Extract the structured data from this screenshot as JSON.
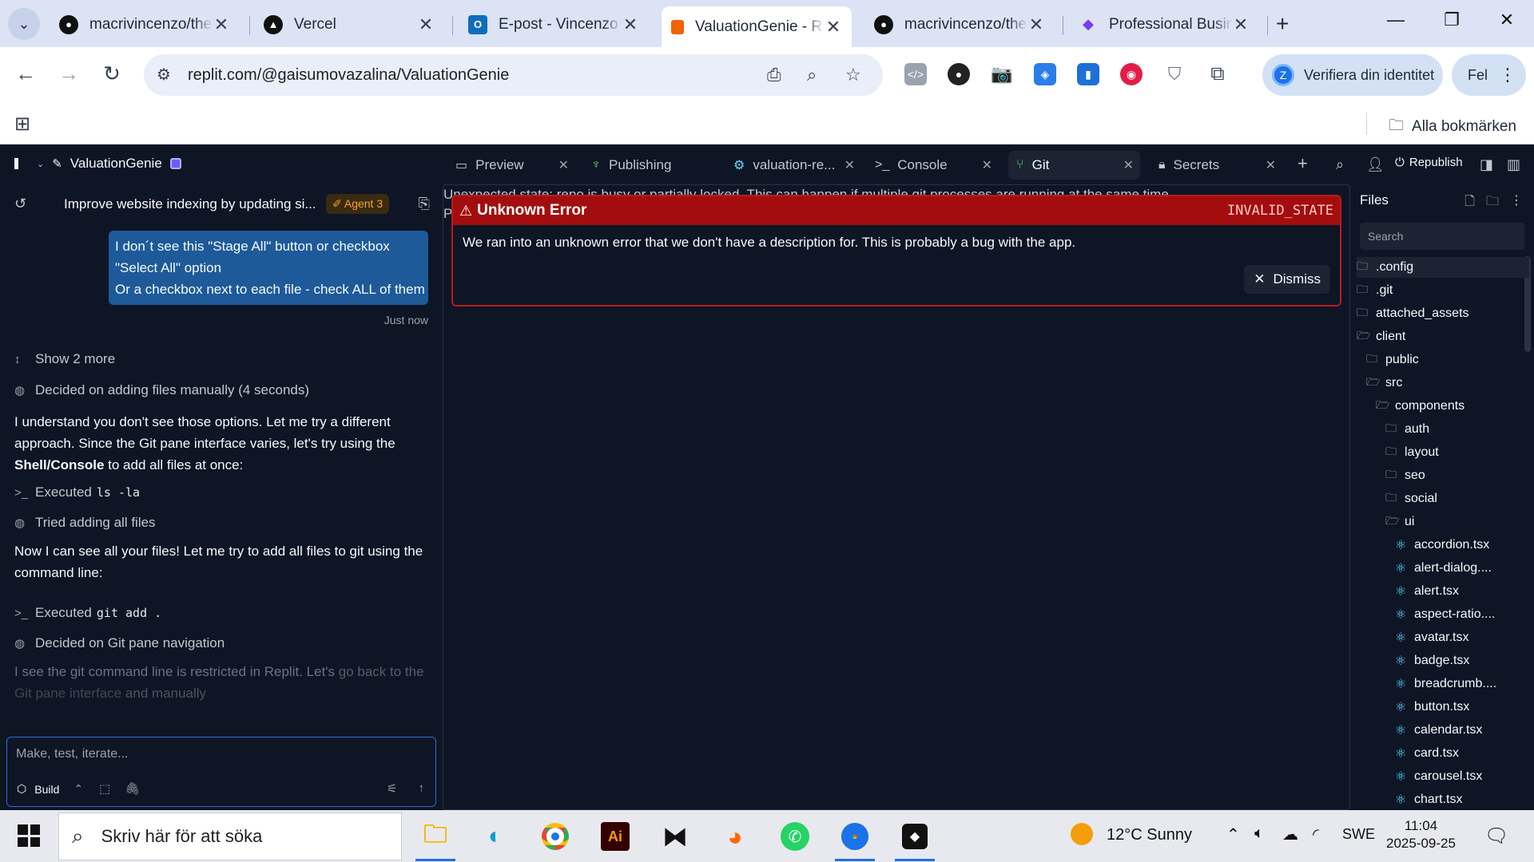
{
  "browser": {
    "tabs": [
      {
        "title": "macrivincenzo/the",
        "icon": "github-icon"
      },
      {
        "title": "Vercel",
        "icon": "vercel-icon"
      },
      {
        "title": "E-post - Vincenzo",
        "icon": "outlook-icon"
      },
      {
        "title": "ValuationGenie - R",
        "icon": "replit-icon",
        "active": true
      },
      {
        "title": "macrivincenzo/the",
        "icon": "github-icon"
      },
      {
        "title": "Professional Busin",
        "icon": "diamond-icon"
      }
    ],
    "url": "replit.com/@gaisumovazalina/ValuationGenie",
    "profile_label": "Verifiera din identitet",
    "profile_initial": "Z",
    "error_label": "Fel",
    "bookmarks_label": "Alla bokmärken"
  },
  "workspace": {
    "project_name": "ValuationGenie",
    "pane_tabs": [
      {
        "label": "Preview",
        "icon": "monitor-icon"
      },
      {
        "label": "Publishing",
        "icon": "balloon-icon"
      },
      {
        "label": "valuation-re...",
        "icon": "gear-icon"
      },
      {
        "label": "Console",
        "icon": "terminal-icon"
      },
      {
        "label": "Git",
        "icon": "git-branch-icon",
        "active": true
      },
      {
        "label": "Secrets",
        "icon": "lock-icon"
      }
    ],
    "republish_label": "Republish"
  },
  "agent": {
    "thread_title": "Improve website indexing by updating si...",
    "agent_badge": "Agent 3",
    "user_message_lines": [
      "I don´t see this \"Stage All\" button or checkbox",
      "\"Select All\" option",
      "Or a checkbox next to each file - check ALL of them"
    ],
    "timestamp": "Just now",
    "show_more": "Show 2 more",
    "decided_1": "Decided on adding files manually (4 seconds)",
    "para_1_a": "I understand you don't see those options. Let me try a different approach. Since the Git pane interface varies, let's try using the ",
    "para_1_bold": "Shell/Console",
    "para_1_b": " to add all files at once:",
    "executed_label": "Executed",
    "executed_1_cmd": "ls -la",
    "tried": "Tried adding all files",
    "para_2": "Now I can see all your files! Let me try to add all files to git using the command line:",
    "executed_2_cmd": "git add .",
    "decided_2": "Decided on Git pane navigation",
    "para_3_a": "I see the git command line is restricted in Replit. Let's ",
    "para_3_b": "go back to the",
    "para_3_c": "Git pane interface",
    "para_3_d": " and manually",
    "composer_placeholder": "Make, test, iterate...",
    "build_label": "Build"
  },
  "git_pane": {
    "bg_line": "Unexpected state: repo is busy or partially locked. This can happen if multiple git processes are running at the same time.",
    "bg_line_2": "P",
    "error_title": "Unknown Error",
    "error_code": "INVALID_STATE",
    "error_message": "We ran into an unknown error that we don't have a description for. This is probably a bug with the app.",
    "dismiss_label": "Dismiss"
  },
  "files": {
    "header": "Files",
    "search_placeholder": "Search",
    "tree": [
      {
        "name": ".config",
        "type": "folder",
        "depth": 0
      },
      {
        "name": ".git",
        "type": "folder",
        "depth": 0
      },
      {
        "name": "attached_assets",
        "type": "folder",
        "depth": 0
      },
      {
        "name": "client",
        "type": "folder-open",
        "depth": 0
      },
      {
        "name": "public",
        "type": "folder",
        "depth": 1
      },
      {
        "name": "src",
        "type": "folder-open",
        "depth": 1
      },
      {
        "name": "components",
        "type": "folder-open",
        "depth": 2
      },
      {
        "name": "auth",
        "type": "folder",
        "depth": 3
      },
      {
        "name": "layout",
        "type": "folder",
        "depth": 3
      },
      {
        "name": "seo",
        "type": "folder",
        "depth": 3
      },
      {
        "name": "social",
        "type": "folder",
        "depth": 3
      },
      {
        "name": "ui",
        "type": "folder-open",
        "depth": 3
      },
      {
        "name": "accordion.tsx",
        "type": "react",
        "depth": 4
      },
      {
        "name": "alert-dialog....",
        "type": "react",
        "depth": 4
      },
      {
        "name": "alert.tsx",
        "type": "react",
        "depth": 4
      },
      {
        "name": "aspect-ratio....",
        "type": "react",
        "depth": 4
      },
      {
        "name": "avatar.tsx",
        "type": "react",
        "depth": 4
      },
      {
        "name": "badge.tsx",
        "type": "react",
        "depth": 4
      },
      {
        "name": "breadcrumb....",
        "type": "react",
        "depth": 4
      },
      {
        "name": "button.tsx",
        "type": "react",
        "depth": 4
      },
      {
        "name": "calendar.tsx",
        "type": "react",
        "depth": 4
      },
      {
        "name": "card.tsx",
        "type": "react",
        "depth": 4
      },
      {
        "name": "carousel.tsx",
        "type": "react",
        "depth": 4
      },
      {
        "name": "chart.tsx",
        "type": "react",
        "depth": 4
      }
    ]
  },
  "taskbar": {
    "search_placeholder": "Skriv här för att söka",
    "weather": "12°C  Sunny",
    "language": "SWE",
    "time": "11:04",
    "date": "2025-09-25"
  }
}
